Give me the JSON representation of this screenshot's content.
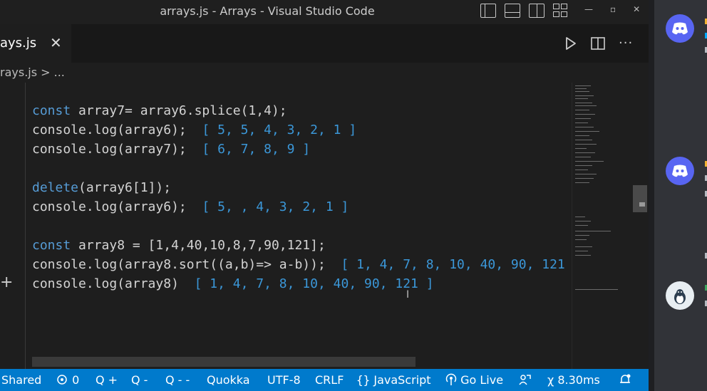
{
  "window": {
    "title": "arrays.js - Arrays - Visual Studio Code",
    "controls": [
      "—",
      "▫",
      "✕"
    ]
  },
  "tab": {
    "label": "ays.js",
    "close": "✕"
  },
  "breadcrumb": {
    "text": "rays.js  >  ..."
  },
  "editor": {
    "line1": {
      "kw": "const",
      "rest": " array7= array6.splice(1,4);"
    },
    "line2": {
      "code": "console.log(array6);",
      "result": "[ 5, 5, 4, 3, 2, 1 ]"
    },
    "line3": {
      "code": "console.log(array7);",
      "result": "[ 6, 7, 8, 9 ]"
    },
    "line4": {
      "kw": "delete",
      "rest": "(array6[1]);"
    },
    "line5": {
      "code": "console.log(array6);",
      "result": "[ 5, , 4, 3, 2, 1 ]"
    },
    "line6": {
      "kw": "const",
      "rest": " array8 = [1,4,40,10,8,7,90,121];"
    },
    "line7": {
      "code": "console.log(array8.sort((a,b)=> a-b));",
      "result": "[ 1, 4, 7, 8, 10, 40, 90, 121"
    },
    "line8": {
      "code": "console.log(array8)",
      "result": "[ 1, 4, 7, 8, 10, 40, 90, 121 ]"
    },
    "add_symbol": "+"
  },
  "statusbar": {
    "shared": "Shared",
    "ports": "0",
    "q_plus": "Q +",
    "q_minus": "Q -",
    "q_minus_minus": "Q - -",
    "quokka": "Quokka",
    "encoding": "UTF-8",
    "eol": "CRLF",
    "language": "JavaScript",
    "go_live": "Go Live",
    "timing": "8.30ms"
  },
  "colors": {
    "statusbar": "#007acc",
    "keyword": "#569cd6",
    "quokka_result": "#3b97d8",
    "discord": "#5865f2"
  }
}
